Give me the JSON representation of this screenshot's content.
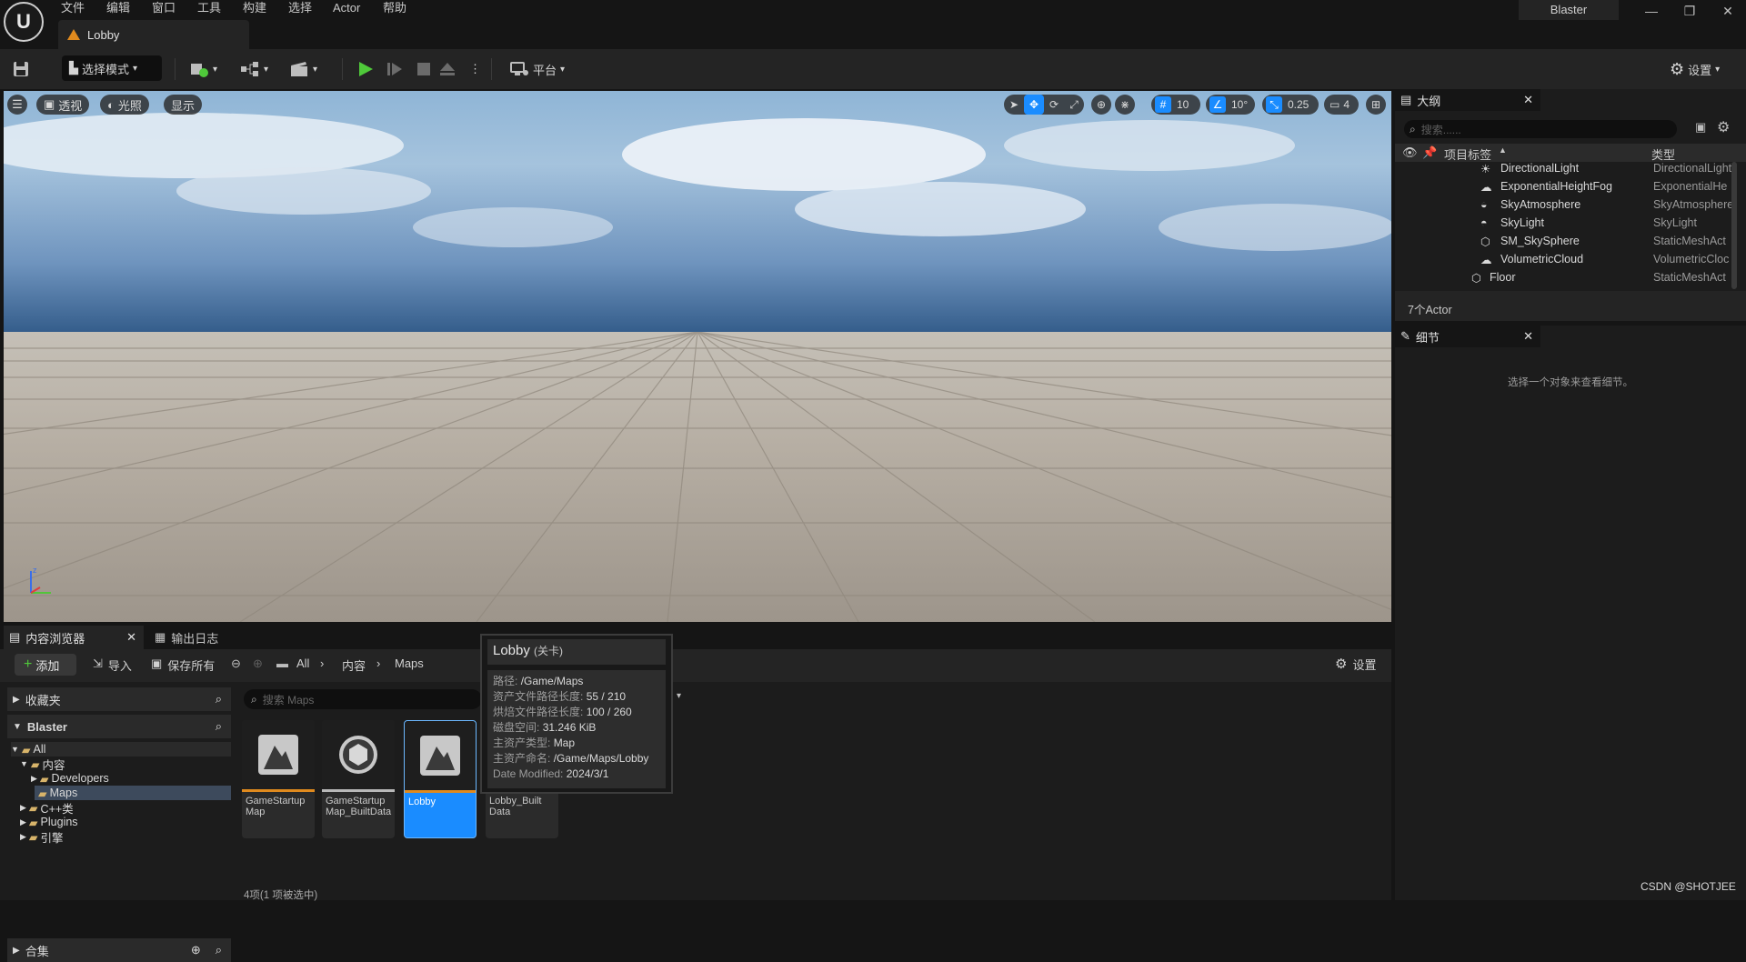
{
  "menu": [
    "文件",
    "编辑",
    "窗口",
    "工具",
    "构建",
    "选择",
    "Actor",
    "帮助"
  ],
  "doc_tab": "Lobby",
  "project_name": "Blaster",
  "toolbar": {
    "mode_label": "选择模式",
    "platform_label": "平台",
    "settings_label": "设置"
  },
  "viewport": {
    "perspective": "透视",
    "lighting": "光照",
    "show": "显示",
    "grid_snap": "10",
    "rotation_snap": "10°",
    "scale_snap": "0.25",
    "camera_speed": "4"
  },
  "outliner": {
    "title": "大纲",
    "search_placeholder": "搜索......",
    "col_label": "项目标签",
    "col_type": "类型",
    "rows": [
      {
        "label": "DirectionalLight",
        "type": "DirectionalLight",
        "icon": "directional-light-icon"
      },
      {
        "label": "ExponentialHeightFog",
        "type": "ExponentialHe",
        "icon": "fog-icon"
      },
      {
        "label": "SkyAtmosphere",
        "type": "SkyAtmosphere",
        "icon": "sky-atmosphere-icon"
      },
      {
        "label": "SkyLight",
        "type": "SkyLight",
        "icon": "sky-light-icon"
      },
      {
        "label": "SM_SkySphere",
        "type": "StaticMeshAct",
        "icon": "static-mesh-icon"
      },
      {
        "label": "VolumetricCloud",
        "type": "VolumetricCloc",
        "icon": "cloud-icon"
      },
      {
        "label": "Floor",
        "type": "StaticMeshAct",
        "icon": "static-mesh-icon"
      }
    ],
    "count": "7个Actor"
  },
  "details": {
    "title": "细节",
    "empty_msg": "选择一个对象来查看细节。"
  },
  "content_browser": {
    "tab_label": "内容浏览器",
    "log_tab_label": "输出日志",
    "add_label": "添加",
    "import_label": "导入",
    "save_all_label": "保存所有",
    "settings_label": "设置",
    "breadcrumb": [
      "All",
      "内容",
      "Maps"
    ],
    "favorites": "收藏夹",
    "project": "Blaster",
    "tree": [
      "All",
      "内容",
      "Developers",
      "Maps",
      "C++类",
      "Plugins",
      "引擎"
    ],
    "collections": "合集",
    "search_placeholder": "搜索 Maps",
    "assets": [
      {
        "name": "GameStartup Map",
        "bar_color": "#e08a1e"
      },
      {
        "name": "GameStartup Map_BuiltData",
        "bar_color": "#b8b8b8"
      },
      {
        "name": "Lobby",
        "bar_color": "#e08a1e"
      },
      {
        "name": "Lobby_Built Data",
        "bar_color": "#b8b8b8"
      }
    ],
    "status": "4项(1 项被选中)"
  },
  "tooltip": {
    "title": "Lobby",
    "title_suffix": "(关卡)",
    "rows": [
      {
        "k": "路径:",
        "v": "/Game/Maps"
      },
      {
        "k": "资产文件路径长度:",
        "v": "55 / 210"
      },
      {
        "k": "烘焙文件路径长度:",
        "v": "100 / 260"
      },
      {
        "k": "磁盘空间:",
        "v": "31.246 KiB"
      },
      {
        "k": "主资产类型:",
        "v": "Map"
      },
      {
        "k": "主资产命名:",
        "v": "/Game/Maps/Lobby"
      },
      {
        "k": "Date Modified:",
        "v": "2024/3/1"
      }
    ]
  },
  "watermark": "CSDN @SHOTJEE",
  "colors": {
    "accent": "#1a8cff",
    "play": "#4fc93a",
    "asset_level": "#e08a1e"
  }
}
